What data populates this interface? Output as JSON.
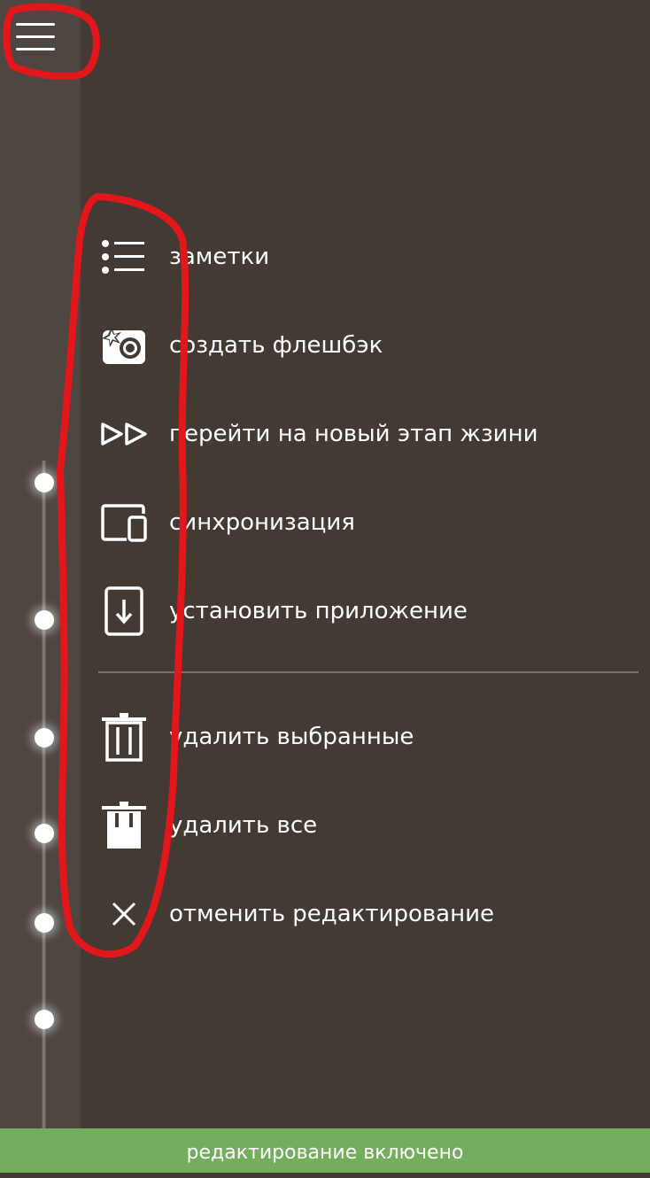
{
  "header": {
    "menu_icon": "hamburger-menu-icon"
  },
  "menu": {
    "items": [
      {
        "label": "заметки",
        "icon": "list-icon"
      },
      {
        "label": "создать флешбэк",
        "icon": "camera-flash-icon"
      },
      {
        "label": "перейти на новый этап жзини",
        "icon": "fast-forward-icon"
      },
      {
        "label": "синхронизация",
        "icon": "devices-sync-icon"
      },
      {
        "label": "установить приложение",
        "icon": "install-app-icon"
      }
    ],
    "edit_items": [
      {
        "label": "удалить выбранные",
        "icon": "trash-icon"
      },
      {
        "label": "удалить все",
        "icon": "trash-filled-icon"
      },
      {
        "label": "отменить редактирование",
        "icon": "close-icon"
      }
    ]
  },
  "status": {
    "text": "редактирование включено",
    "color": "#74ad5d"
  },
  "colors": {
    "background": "#433a34",
    "sidebar": "#4e4640",
    "annotation": "#e3161b"
  }
}
